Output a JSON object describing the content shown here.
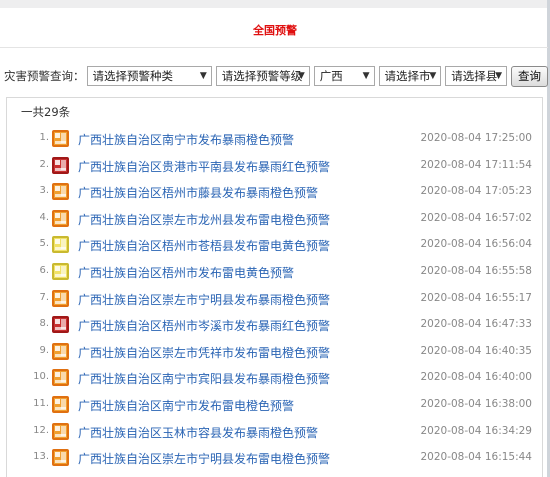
{
  "header": {
    "banner": "全国预警"
  },
  "filter": {
    "label": "灾害预警查询：",
    "type_select": "请选择预警种类",
    "level_select": "请选择预警等级",
    "province_select": "广西",
    "city_select": "请选择市",
    "county_select": "请选择县",
    "query_button": "查询"
  },
  "list": {
    "count_text": "一共29条",
    "items": [
      {
        "num": "1.",
        "title": "广西壮族自治区南宁市发布暴雨橙色预警",
        "time": "2020-08-04 17:25:00",
        "color": "orange",
        "icon": "rainstorm-orange-warning-icon"
      },
      {
        "num": "2.",
        "title": "广西壮族自治区贵港市平南县发布暴雨红色预警",
        "time": "2020-08-04 17:11:54",
        "color": "red",
        "icon": "rainstorm-red-warning-icon"
      },
      {
        "num": "3.",
        "title": "广西壮族自治区梧州市藤县发布暴雨橙色预警",
        "time": "2020-08-04 17:05:23",
        "color": "orange",
        "icon": "rainstorm-orange-warning-icon"
      },
      {
        "num": "4.",
        "title": "广西壮族自治区崇左市龙州县发布雷电橙色预警",
        "time": "2020-08-04 16:57:02",
        "color": "orange",
        "icon": "thunder-orange-warning-icon"
      },
      {
        "num": "5.",
        "title": "广西壮族自治区梧州市苍梧县发布雷电黄色预警",
        "time": "2020-08-04 16:56:04",
        "color": "yellow",
        "icon": "thunder-yellow-warning-icon"
      },
      {
        "num": "6.",
        "title": "广西壮族自治区梧州市发布雷电黄色预警",
        "time": "2020-08-04 16:55:58",
        "color": "yellow",
        "icon": "thunder-yellow-warning-icon"
      },
      {
        "num": "7.",
        "title": "广西壮族自治区崇左市宁明县发布暴雨橙色预警",
        "time": "2020-08-04 16:55:17",
        "color": "orange",
        "icon": "rainstorm-orange-warning-icon"
      },
      {
        "num": "8.",
        "title": "广西壮族自治区梧州市岑溪市发布暴雨红色预警",
        "time": "2020-08-04 16:47:33",
        "color": "red",
        "icon": "rainstorm-red-warning-icon"
      },
      {
        "num": "9.",
        "title": "广西壮族自治区崇左市凭祥市发布雷电橙色预警",
        "time": "2020-08-04 16:40:35",
        "color": "orange",
        "icon": "thunder-orange-warning-icon"
      },
      {
        "num": "10.",
        "title": "广西壮族自治区南宁市宾阳县发布暴雨橙色预警",
        "time": "2020-08-04 16:40:00",
        "color": "orange",
        "icon": "rainstorm-orange-warning-icon"
      },
      {
        "num": "11.",
        "title": "广西壮族自治区南宁市发布雷电橙色预警",
        "time": "2020-08-04 16:38:00",
        "color": "orange",
        "icon": "thunder-orange-warning-icon"
      },
      {
        "num": "12.",
        "title": "广西壮族自治区玉林市容县发布暴雨橙色预警",
        "time": "2020-08-04 16:34:29",
        "color": "orange",
        "icon": "rainstorm-orange-warning-icon"
      },
      {
        "num": "13.",
        "title": "广西壮族自治区崇左市宁明县发布雷电橙色预警",
        "time": "2020-08-04 16:15:44",
        "color": "orange",
        "icon": "thunder-orange-warning-icon"
      }
    ]
  }
}
